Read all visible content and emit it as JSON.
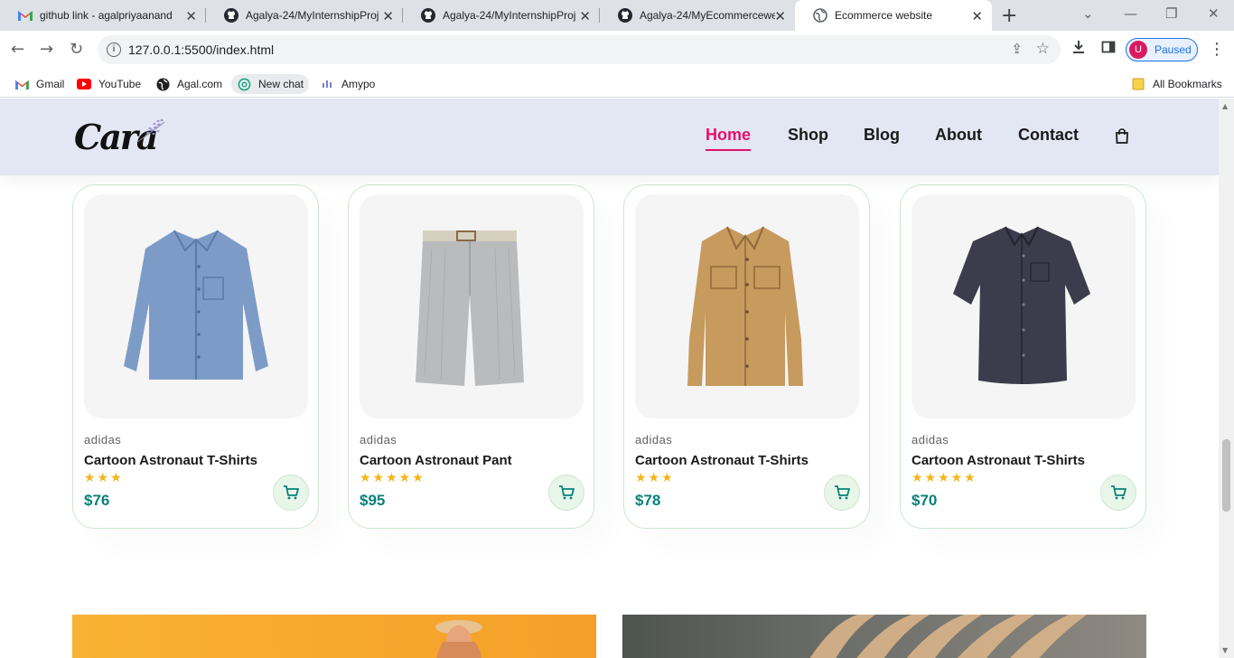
{
  "browser": {
    "tabs": [
      {
        "title": "github link - agalpriyaanand",
        "icon": "gmail-icon"
      },
      {
        "title": "Agalya-24/MyInternshipProj",
        "icon": "github-icon"
      },
      {
        "title": "Agalya-24/MyInternshipProj",
        "icon": "github-icon"
      },
      {
        "title": "Agalya-24/MyEcommercewe",
        "icon": "github-icon"
      },
      {
        "title": "Ecommerce website",
        "icon": "globe-icon"
      }
    ],
    "url": "127.0.0.1:5500/index.html",
    "profile_initial": "U",
    "profile_status": "Paused",
    "bookmarks": [
      {
        "label": "Gmail",
        "icon": "gmail-icon"
      },
      {
        "label": "YouTube",
        "icon": "youtube-icon"
      },
      {
        "label": "Agal.com",
        "icon": "globe-icon"
      },
      {
        "label": "New chat",
        "icon": "chatgpt-icon"
      },
      {
        "label": "Amypo",
        "icon": "amypo-icon"
      }
    ],
    "all_bookmarks": "All Bookmarks"
  },
  "site": {
    "logo": "Cara",
    "nav": [
      "Home",
      "Shop",
      "Blog",
      "About",
      "Contact"
    ],
    "active_nav": "Home",
    "accent": "#e3116c",
    "price_color": "#088178",
    "header_bg": "#e3e6f3"
  },
  "products": [
    {
      "brand": "adidas",
      "name": "Cartoon Astronaut T-Shirts",
      "rating": 3,
      "price": "$76",
      "image": "blue-shirt"
    },
    {
      "brand": "adidas",
      "name": "Cartoon Astronaut Pant",
      "rating": 5,
      "price": "$95",
      "image": "grey-shorts"
    },
    {
      "brand": "adidas",
      "name": "Cartoon Astronaut T-Shirts",
      "rating": 3,
      "price": "$78",
      "image": "tan-jacket"
    },
    {
      "brand": "adidas",
      "name": "Cartoon Astronaut T-Shirts",
      "rating": 5,
      "price": "$70",
      "image": "navy-shirt"
    }
  ]
}
